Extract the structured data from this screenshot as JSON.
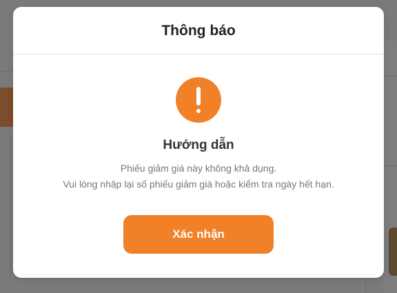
{
  "modal": {
    "title": "Thông báo",
    "icon": "exclamation-circle-icon",
    "heading": "Hướng dẫn",
    "message_line_1": "Phiếu giảm giá này không khả dụng.",
    "message_line_2": "Vui lòng nhập lại số phiếu giảm giá hoặc kiểm tra ngày hết hạn.",
    "confirm_label": "Xác nhận"
  },
  "colors": {
    "accent": "#f08129",
    "overlay": "#7a7a7a",
    "modal_bg": "#ffffff",
    "title_text": "#222222",
    "body_text": "#777777"
  }
}
